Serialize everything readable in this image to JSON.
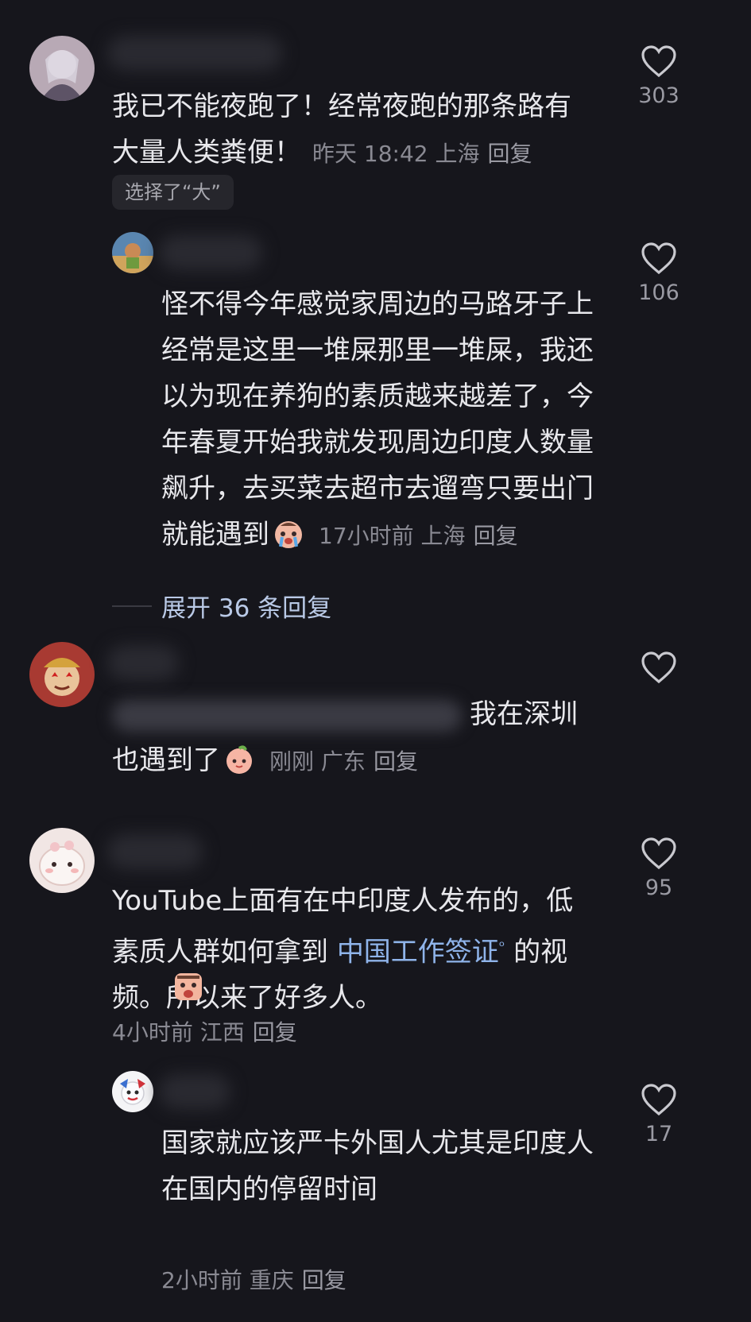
{
  "comments": [
    {
      "text_lines": [
        "我已不能夜跑了！经常夜跑的那条路有",
        "大量人类粪便！"
      ],
      "time": "昨天 18:42",
      "location": "上海",
      "reply": "回复",
      "likes": "303",
      "chip": "选择了“大”"
    },
    {
      "text_lines": [
        "怪不得今年感觉家周边的马路牙子上",
        "经常是这里一堆屎那里一堆屎，我还",
        "以为现在养狗的素质越来越差了，今",
        "年春夏开始我就发现周边印度人数量",
        "飙升，去买菜去超市去遛弯只要出门",
        "就能遇到"
      ],
      "time": "17小时前",
      "location": "上海",
      "reply": "回复",
      "likes": "106",
      "emoji_icon": "crying-face-icon"
    },
    {
      "expand_label": "展开 36 条回复"
    },
    {
      "text_tail": "我在深圳",
      "text_line2": "也遇到了",
      "time": "刚刚",
      "location": "广东",
      "reply": "回复",
      "emoji_icon": "peach-face-icon"
    },
    {
      "text_line1": "YouTube上面有在中印度人发布的，低",
      "text_line2_pre": "素质人群如何拿到 ",
      "text_line2_link": "中国工作签证",
      "text_line2_post": " 的视",
      "text_line3": "频。所以来了好多人。",
      "time": "4小时前",
      "location": "江西",
      "reply": "回复",
      "likes": "95",
      "emoji_icon": "scared-face-icon"
    },
    {
      "text_lines": [
        "国家就应该严卡外国人尤其是印度人",
        "在国内的停留时间"
      ],
      "time": "2小时前",
      "location": "重庆",
      "reply": "回复",
      "likes": "17"
    }
  ]
}
